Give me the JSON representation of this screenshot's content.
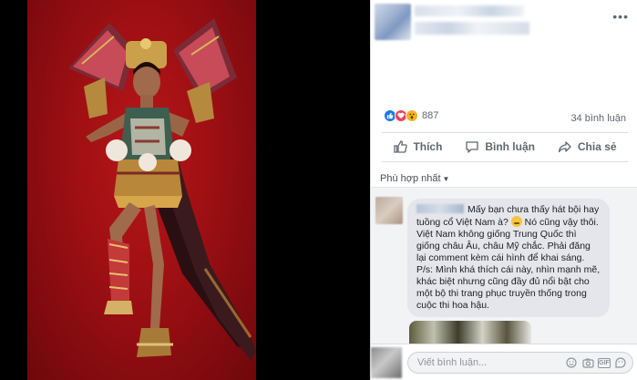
{
  "post": {
    "reaction_count": "887",
    "comment_count": "34 bình luận",
    "actions": {
      "like": "Thích",
      "comment": "Bình luận",
      "share": "Chia sẻ"
    },
    "sort_label": "Phù hợp nhất"
  },
  "comment": {
    "text_1": "Mấy bạn chưa thấy hát bội hay tuồng cổ Việt Nam à?",
    "text_2": "Nó cũng vậy thôi. Việt Nam không giống Trung Quốc thì giống châu Âu, châu Mỹ chắc. Phải đăng lại comment kèm cái hình để khai sáng.",
    "text_3": "P/s: Mình khá thích cái này, nhìn mạnh mẽ, khác biệt nhưng cũng đầy đủ nổi bật cho một bộ thi trang phục truyền thống trong cuộc thi hoa hậu."
  },
  "composer": {
    "placeholder": "Viết bình luận..."
  },
  "colors": {
    "photo_background": "#9c0f13",
    "facebook_blue": "#1877f2",
    "bubble": "#e4e6eb"
  }
}
